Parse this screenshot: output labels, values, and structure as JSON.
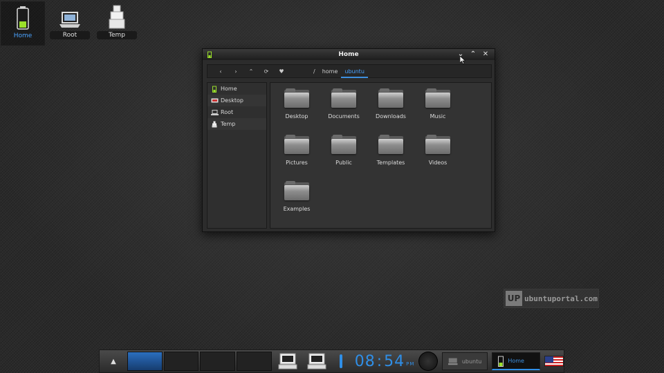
{
  "desktop": {
    "icons": [
      {
        "label": "Home"
      },
      {
        "label": "Root"
      },
      {
        "label": "Temp"
      }
    ]
  },
  "window": {
    "title": "Home",
    "controls": {
      "minimize": "⌄",
      "maximize": "⌃",
      "close": "✕"
    },
    "toolbar": {
      "back": "‹",
      "forward": "›",
      "up": "⌃",
      "refresh": "⟳",
      "favorite": "♥",
      "crumbs": [
        "/",
        "home",
        "ubuntu"
      ]
    },
    "sidebar": [
      {
        "label": "Home"
      },
      {
        "label": "Desktop"
      },
      {
        "label": "Root"
      },
      {
        "label": "Temp"
      }
    ],
    "files": [
      {
        "label": "Desktop"
      },
      {
        "label": "Documents"
      },
      {
        "label": "Downloads"
      },
      {
        "label": "Music"
      },
      {
        "label": "Pictures"
      },
      {
        "label": "Public"
      },
      {
        "label": "Templates"
      },
      {
        "label": "Videos"
      },
      {
        "label": "Examples"
      }
    ]
  },
  "watermark": {
    "badge": "UP",
    "text": "ubuntuportal.com"
  },
  "taskbar": {
    "menu": "▲",
    "clock": {
      "hours": "08",
      "minutes": "54",
      "ampm": "PM"
    },
    "tasks": [
      {
        "label": "ubuntu",
        "state": "inactive"
      },
      {
        "label": "Home",
        "state": "active"
      }
    ],
    "accent": "#2f8fe8"
  }
}
